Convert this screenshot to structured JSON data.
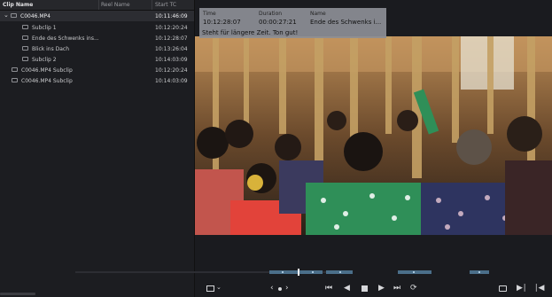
{
  "clip_list": {
    "columns": {
      "clip_name": "Clip Name",
      "reel_name": "Reel Name",
      "start_tc": "Start TC"
    },
    "rows": [
      {
        "name": "C0046.MP4",
        "start_tc": "10:11:46:09",
        "expanded": true,
        "selected": true
      },
      {
        "name": "Subclip 1",
        "start_tc": "10:12:20:24"
      },
      {
        "name": "Ende des Schwenks ins...",
        "start_tc": "10:12:28:07"
      },
      {
        "name": "Blick ins Dach",
        "start_tc": "10:13:26:04"
      },
      {
        "name": "Subclip 2",
        "start_tc": "10:14:03:09"
      },
      {
        "name": "C0046.MP4 Subclip",
        "start_tc": "10:12:20:24"
      },
      {
        "name": "C0046.MP4 Subclip",
        "start_tc": "10:14:03:09"
      }
    ]
  },
  "marker_overlay": {
    "time_label": "Time",
    "duration_label": "Duration",
    "name_label": "Name",
    "time": "10:12:28:07",
    "duration": "00:00:27:21",
    "name": "Ende des Schwenks i...",
    "note": "Steht für längere Zeit. Ton gut!"
  },
  "viewer": {
    "image": "video-frame: crowd of women in colourful clothing inside a bamboo-pillared hall"
  },
  "transport": {
    "icons": [
      "viewer-mode-icon",
      "jog-left-icon",
      "jog-right-icon",
      "skip-to-start-icon",
      "play-reverse-icon",
      "stop-icon",
      "play-icon",
      "skip-to-end-icon",
      "loop-icon",
      "fullscreen-icon",
      "next-clip-icon",
      "previous-clip-icon"
    ]
  },
  "colors": {
    "accent": "#4b6f8a",
    "panel": "#1c1d21",
    "overlay": "#8c8e96"
  }
}
